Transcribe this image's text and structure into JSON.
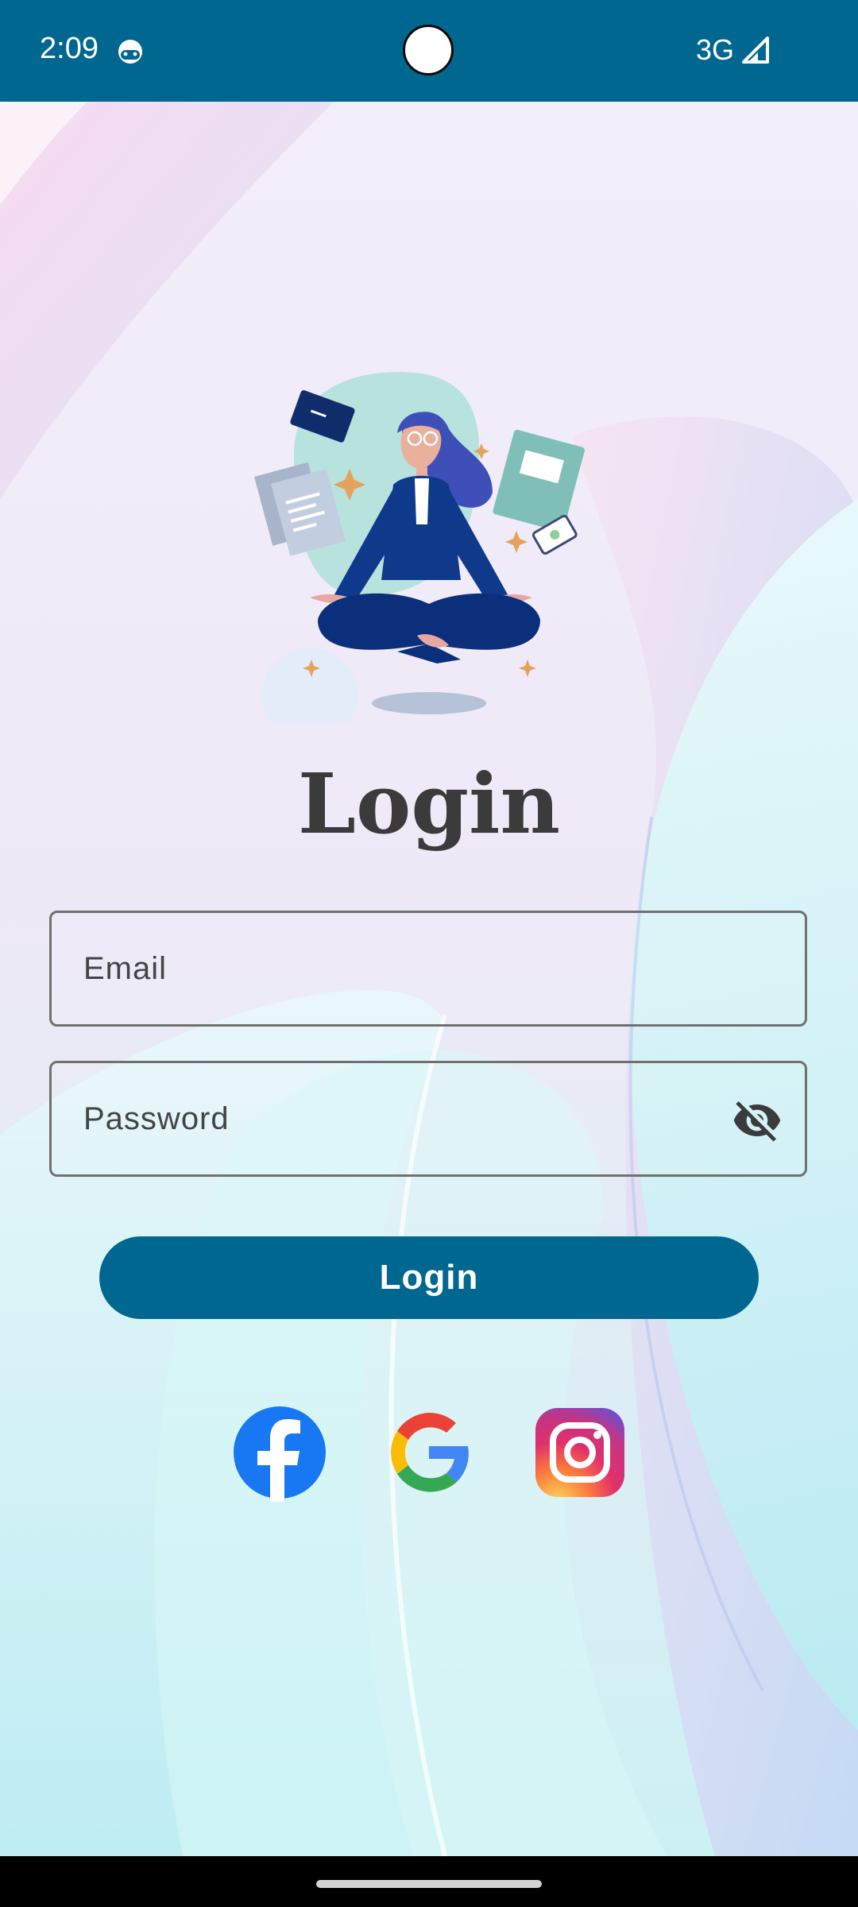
{
  "status_bar": {
    "time": "2:09",
    "network": "3G",
    "app_icon": "android-debug-icon",
    "signal_icon": "signal-icon"
  },
  "illustration": "meditating-woman-illustration",
  "login": {
    "title": "Login",
    "email_placeholder": "Email",
    "password_placeholder": "Password",
    "password_visibility_icon": "visibility-off-icon",
    "button_label": "Login"
  },
  "social": [
    "facebook-icon",
    "google-icon",
    "instagram-icon"
  ],
  "colors": {
    "primary": "#006890",
    "title_text": "#3b3b3b",
    "field_border": "#707070"
  }
}
